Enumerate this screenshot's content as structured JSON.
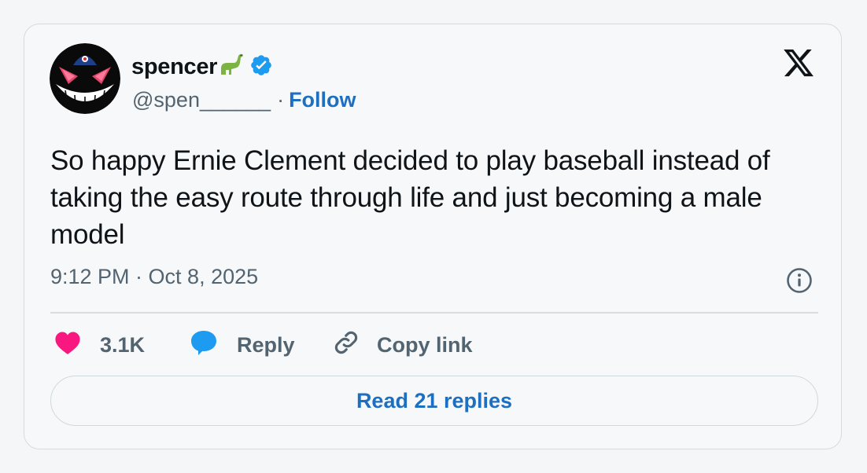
{
  "user": {
    "display_name": "spencer",
    "handle": "@spen______",
    "separator": "·",
    "follow_label": "Follow",
    "name_emoji_icon": "sauropod-dinosaur-icon",
    "verified_icon": "verified-badge-icon",
    "verified_color": "#1d9bf0"
  },
  "tweet": {
    "text": "So happy Ernie Clement decided to play baseball instead of taking the easy route through life and just becoming a male model",
    "timestamp": "9:12 PM · Oct 8, 2025"
  },
  "actions": {
    "like_count": "3.1K",
    "reply_label": "Reply",
    "copy_link_label": "Copy link",
    "like_color": "#f91880",
    "reply_color": "#1d9bf0"
  },
  "footer": {
    "read_replies_label": "Read 21 replies"
  },
  "brand": {
    "logo_icon": "x-logo-icon"
  }
}
